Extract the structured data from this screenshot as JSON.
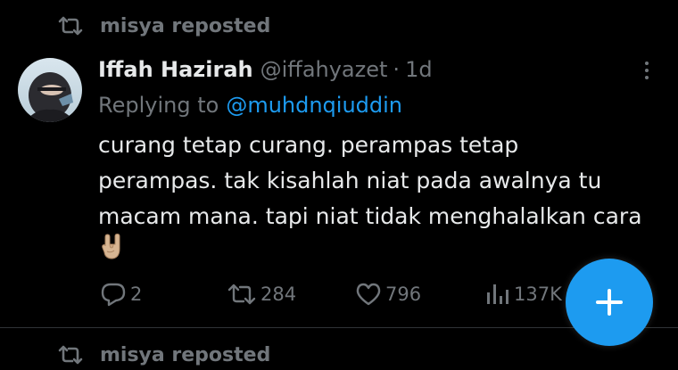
{
  "repost_top": {
    "text": "misya reposted"
  },
  "tweet": {
    "display_name": "Iffah Hazirah",
    "handle": "@iffahyazet",
    "separator": "·",
    "time": "1d",
    "replying_to_label": "Replying to",
    "replying_to_mention": "@muhdnqiuddin",
    "text_lines": [
      "curang tetap curang. perampas tetap",
      "perampas. tak kisahlah niat pada awalnya tu",
      "macam mana. tapi niat tidak menghalalkan cara"
    ],
    "emoji": "sign-of-horns-emoji"
  },
  "actions": {
    "replies": "2",
    "reposts": "284",
    "likes": "796",
    "views": "137K"
  },
  "repost_bottom": {
    "text": "misya reposted"
  },
  "colors": {
    "background": "#000000",
    "text": "#e7e9ea",
    "muted": "#71767b",
    "accent": "#1d9bf0",
    "divider": "#2f3336"
  },
  "icons": {
    "repost": "repost-icon",
    "reply": "reply-icon",
    "like": "heart-icon",
    "views": "analytics-icon",
    "more": "more-icon",
    "compose": "plus-icon"
  }
}
